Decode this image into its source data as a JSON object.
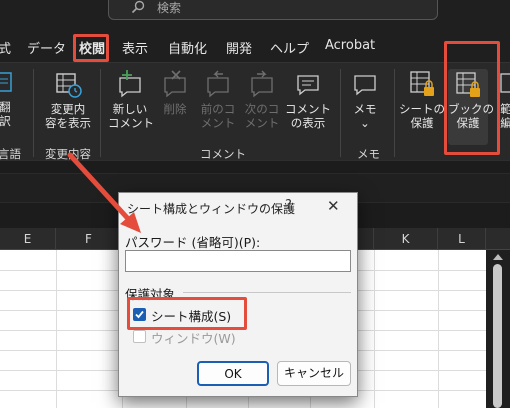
{
  "search": {
    "placeholder": "検索",
    "icon": "search-icon"
  },
  "tabs": [
    {
      "label": "式"
    },
    {
      "label": "データ"
    },
    {
      "label": "校閲",
      "active": true
    },
    {
      "label": "表示"
    },
    {
      "label": "自動化"
    },
    {
      "label": "開発"
    },
    {
      "label": "ヘルプ"
    },
    {
      "label": "Acrobat"
    }
  ],
  "ribbon": {
    "left_partial": {
      "line1": "翻",
      "line2": "訳",
      "group": "言語"
    },
    "track_changes": {
      "line1": "変更内",
      "line2": "容を表示",
      "group": "変更内容"
    },
    "new_comment": {
      "line1": "新しい",
      "line2": "コメント"
    },
    "delete": {
      "line1": "削除"
    },
    "prev_comment": {
      "line1": "前のコ",
      "line2": "メント"
    },
    "next_comment": {
      "line1": "次のコ",
      "line2": "メント"
    },
    "show_comments": {
      "line1": "コメント",
      "line2": "の表示"
    },
    "comments_group": "コメント",
    "notes": {
      "line1": "メモ",
      "line2": "⌄",
      "group": "メモ"
    },
    "protect_sheet": {
      "line1": "シートの",
      "line2": "保護"
    },
    "protect_workbook": {
      "line1": "ブックの",
      "line2": "保護"
    },
    "right_partial": {
      "line1": "範",
      "line2": "編"
    }
  },
  "columns": [
    "E",
    "F",
    "G",
    "H",
    "I",
    "J",
    "K",
    "L"
  ],
  "dialog": {
    "title": "シート構成とウィンドウの保護",
    "help": "?",
    "close": "✕",
    "password_label": "パスワード (省略可)(P):",
    "password_value": "",
    "section": "保護対象",
    "option_structure": "シート構成(S)",
    "option_structure_checked": true,
    "option_windows": "ウィンドウ(W)",
    "option_windows_checked": false,
    "ok": "OK",
    "cancel": "キャンセル"
  },
  "colors": {
    "accent": "#1a5fb4",
    "annotation": "#e44c3c",
    "tab_underline": "#4aa05a"
  }
}
